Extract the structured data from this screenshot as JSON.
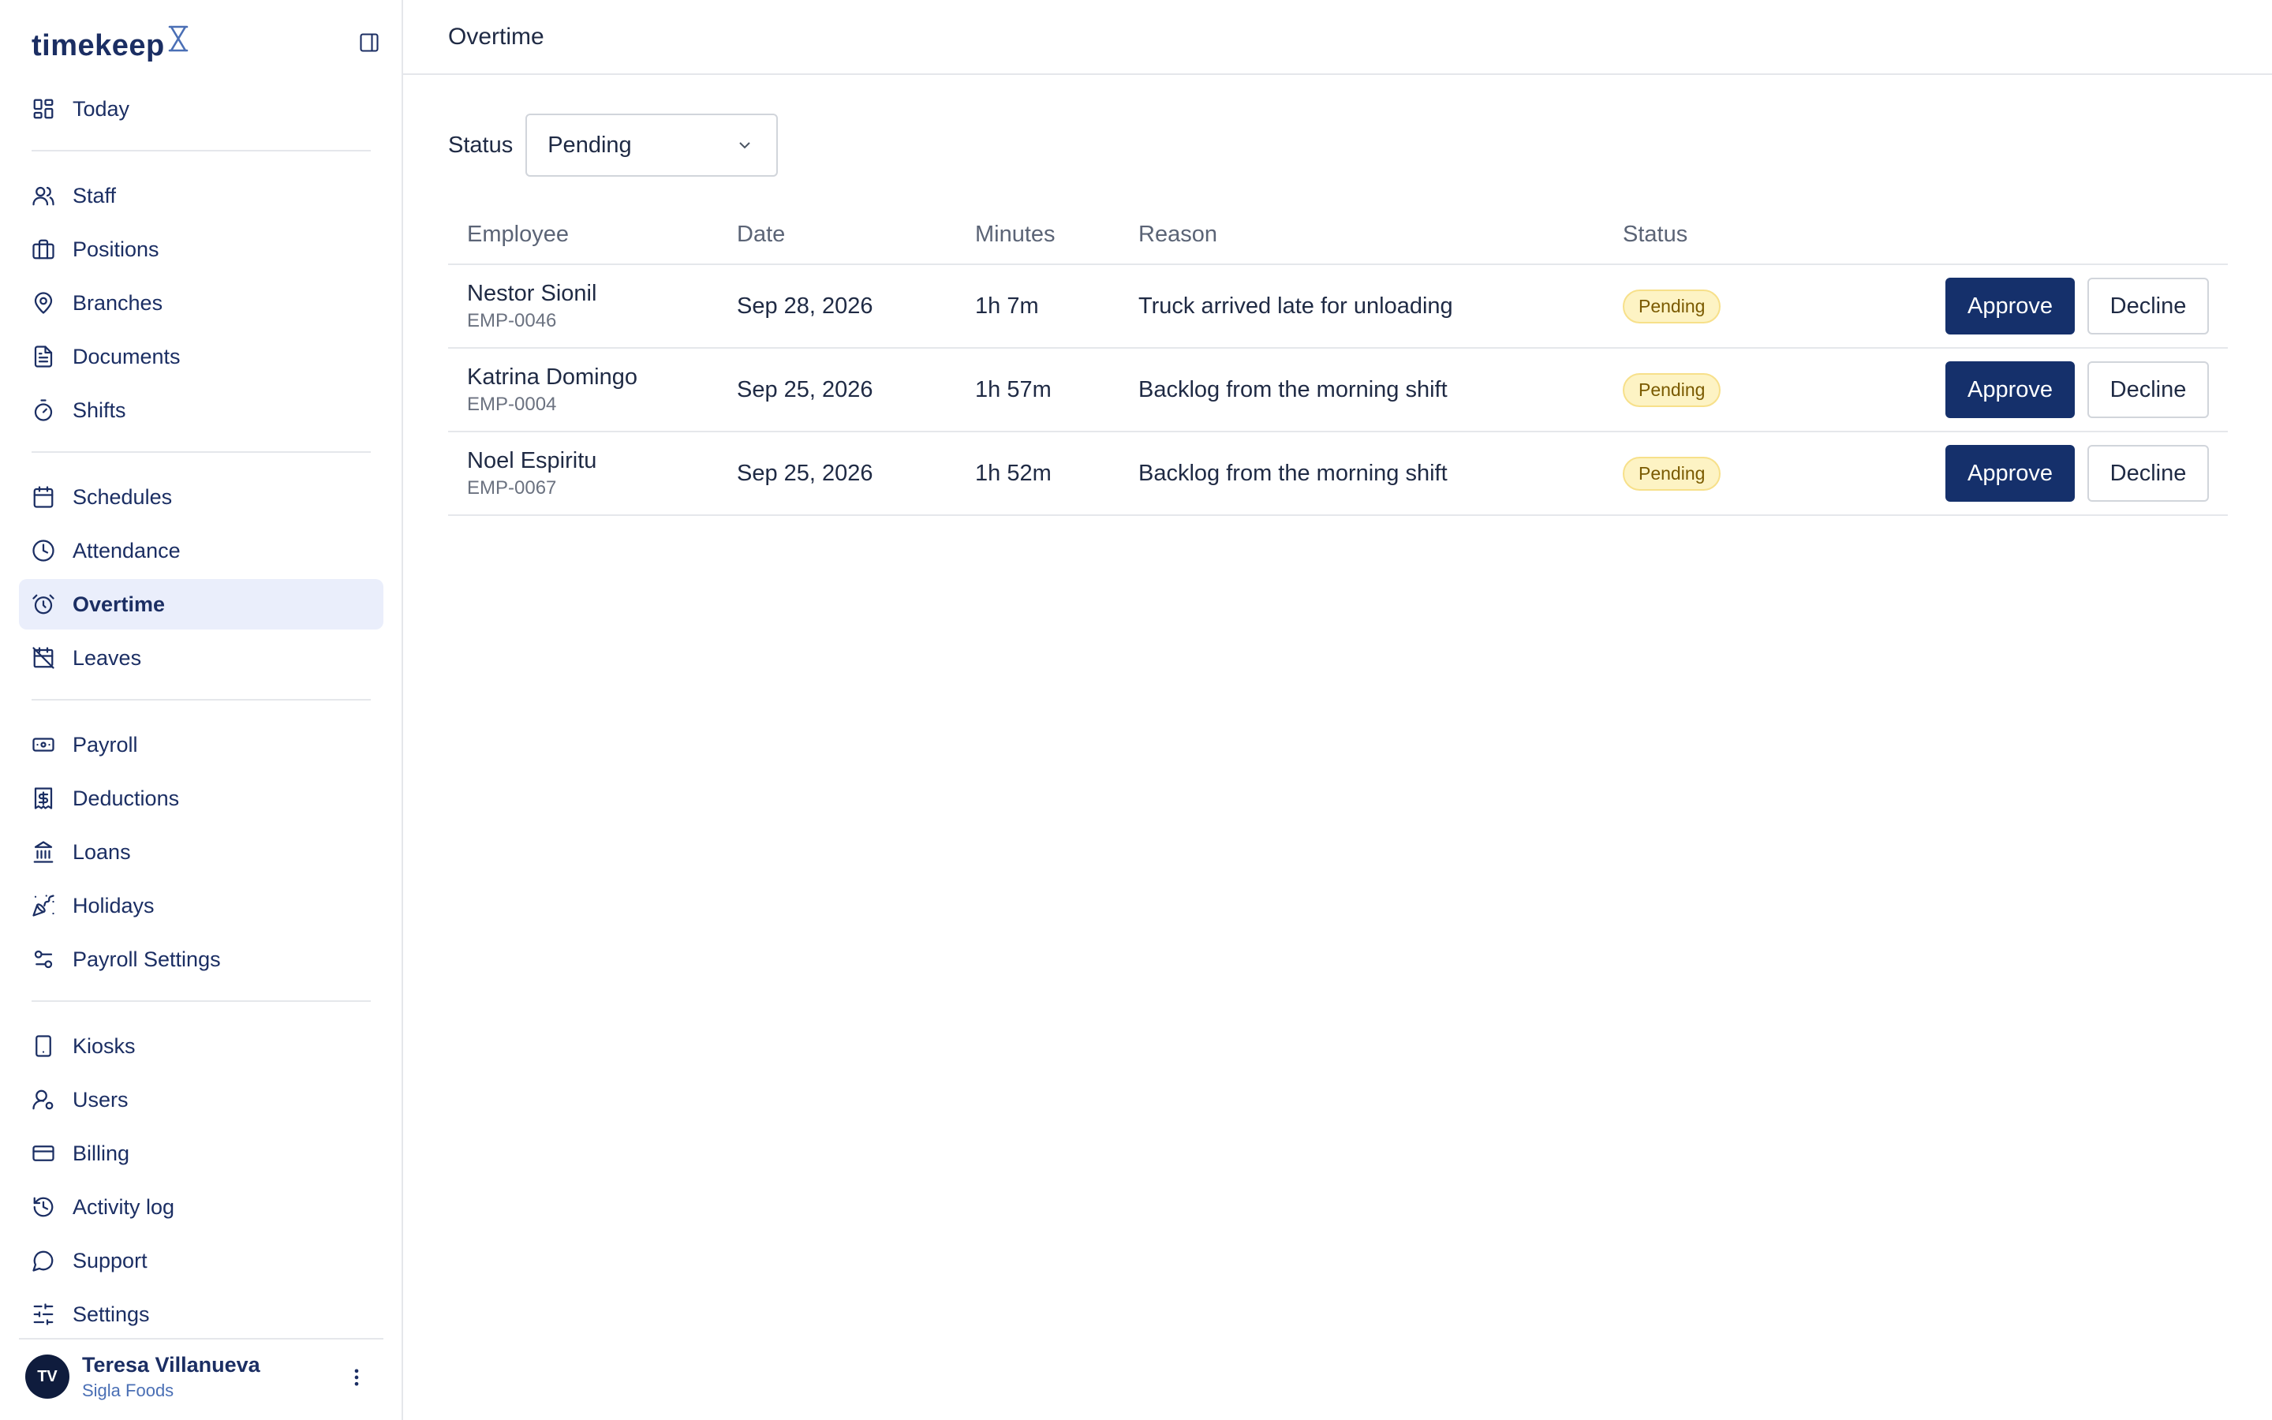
{
  "brand": {
    "name": "timekeep"
  },
  "sidebar": {
    "groups": [
      [
        {
          "label": "Today",
          "icon": "dashboard-icon"
        }
      ],
      [
        {
          "label": "Staff",
          "icon": "users-icon"
        },
        {
          "label": "Positions",
          "icon": "briefcase-icon"
        },
        {
          "label": "Branches",
          "icon": "map-pin-icon"
        },
        {
          "label": "Documents",
          "icon": "document-icon"
        },
        {
          "label": "Shifts",
          "icon": "timer-icon"
        }
      ],
      [
        {
          "label": "Schedules",
          "icon": "calendar-icon"
        },
        {
          "label": "Attendance",
          "icon": "clock-icon"
        },
        {
          "label": "Overtime",
          "icon": "alarm-clock-icon"
        },
        {
          "label": "Leaves",
          "icon": "calendar-off-icon"
        }
      ],
      [
        {
          "label": "Payroll",
          "icon": "banknote-icon"
        },
        {
          "label": "Deductions",
          "icon": "receipt-dollar-icon"
        },
        {
          "label": "Loans",
          "icon": "bank-icon"
        },
        {
          "label": "Holidays",
          "icon": "party-popper-icon"
        },
        {
          "label": "Payroll Settings",
          "icon": "sliders-icon"
        }
      ],
      [
        {
          "label": "Kiosks",
          "icon": "tablet-icon"
        },
        {
          "label": "Users",
          "icon": "user-cog-icon"
        },
        {
          "label": "Billing",
          "icon": "credit-card-icon"
        },
        {
          "label": "Activity log",
          "icon": "history-icon"
        },
        {
          "label": "Support",
          "icon": "chat-bubble-icon"
        },
        {
          "label": "Settings",
          "icon": "settings-sliders-icon"
        }
      ]
    ],
    "active": "Overtime",
    "user": {
      "initials": "TV",
      "name": "Teresa Villanueva",
      "org": "Sigla Foods"
    }
  },
  "header": {
    "title": "Overtime"
  },
  "filter": {
    "label": "Status",
    "value": "Pending"
  },
  "table": {
    "headers": [
      "Employee",
      "Date",
      "Minutes",
      "Reason",
      "Status"
    ],
    "rows": [
      {
        "name": "Nestor Sionil",
        "id": "EMP-0046",
        "date": "Sep 28, 2026",
        "minutes": "1h 7m",
        "reason": "Truck arrived late for unloading",
        "status": "Pending"
      },
      {
        "name": "Katrina Domingo",
        "id": "EMP-0004",
        "date": "Sep 25, 2026",
        "minutes": "1h 57m",
        "reason": "Backlog from the morning shift",
        "status": "Pending"
      },
      {
        "name": "Noel Espiritu",
        "id": "EMP-0067",
        "date": "Sep 25, 2026",
        "minutes": "1h 52m",
        "reason": "Backlog from the morning shift",
        "status": "Pending"
      }
    ],
    "approve_label": "Approve",
    "decline_label": "Decline"
  },
  "colors": {
    "primary": "#15306b",
    "active_bg": "#eaeefb",
    "badge_bg": "#fdf3c4",
    "text": "#1b2e63"
  }
}
